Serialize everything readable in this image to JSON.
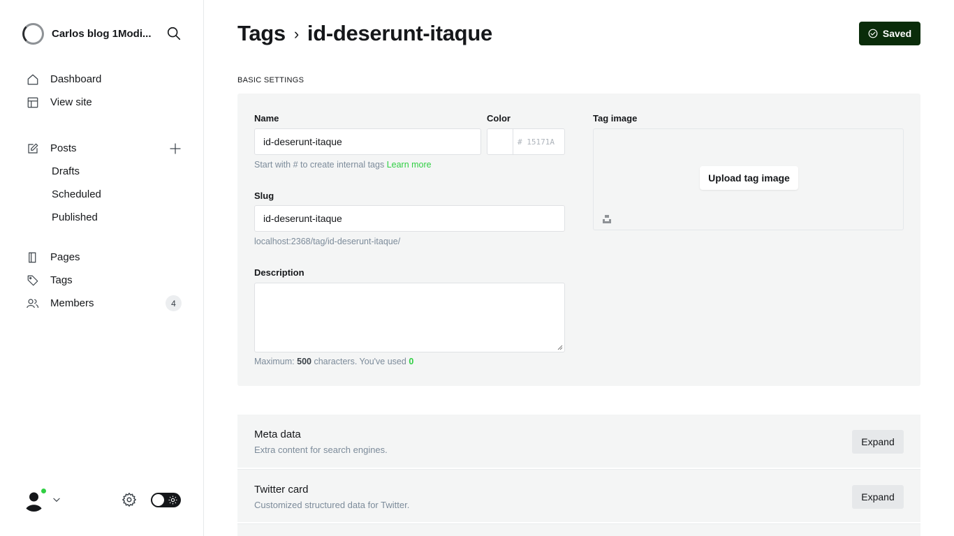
{
  "sidebar": {
    "site_title": "Carlos blog 1Modi...",
    "nav": {
      "dashboard": "Dashboard",
      "view_site": "View site",
      "posts": "Posts",
      "drafts": "Drafts",
      "scheduled": "Scheduled",
      "published": "Published",
      "pages": "Pages",
      "tags": "Tags",
      "members": "Members",
      "members_count": "4"
    }
  },
  "header": {
    "breadcrumb_root": "Tags",
    "breadcrumb_current": "id-deserunt-itaque",
    "saved_label": "Saved"
  },
  "basic_settings": {
    "section_label": "BASIC SETTINGS",
    "name_label": "Name",
    "name_value": "id-deserunt-itaque",
    "name_hint": "Start with # to create internal tags",
    "learn_more": "Learn more",
    "color_label": "Color",
    "color_value": "# 15171A",
    "slug_label": "Slug",
    "slug_value": "id-deserunt-itaque",
    "slug_url": "localhost:2368/tag/id-deserunt-itaque/",
    "description_label": "Description",
    "desc_hint_prefix": "Maximum:",
    "desc_max": "500",
    "desc_hint_middle": "characters. You've used",
    "desc_used": "0",
    "tag_image_label": "Tag image",
    "upload_label": "Upload tag image"
  },
  "expandables": [
    {
      "title": "Meta data",
      "desc": "Extra content for search engines.",
      "button": "Expand"
    },
    {
      "title": "Twitter card",
      "desc": "Customized structured data for Twitter.",
      "button": "Expand"
    }
  ],
  "colors": {
    "accent": "#30cf43",
    "saved_bg": "#0a2c0a",
    "text": "#15171a",
    "muted": "#7c8b9a"
  }
}
